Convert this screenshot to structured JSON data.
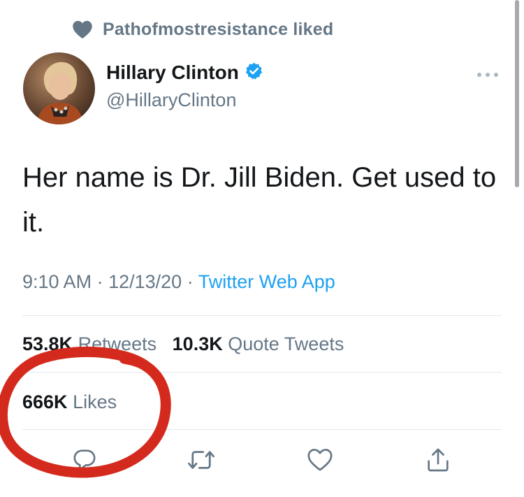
{
  "social_context": {
    "text": "Pathofmostresistance liked",
    "icon": "heart-icon"
  },
  "author": {
    "display_name": "Hillary Clinton",
    "handle": "@HillaryClinton",
    "verified": true,
    "verified_icon": "verified-badge-icon"
  },
  "tweet": {
    "text": "Her name is Dr. Jill Biden. Get used to it."
  },
  "meta": {
    "time": "9:10 AM",
    "date": "12/13/20",
    "separator": "·",
    "source": "Twitter Web App"
  },
  "stats": {
    "retweets_count": "53.8K",
    "retweets_label": "Retweets",
    "quote_count": "10.3K",
    "quote_label": "Quote Tweets",
    "likes_count": "666K",
    "likes_label": "Likes"
  },
  "actions": [
    {
      "name": "reply",
      "icon": "reply-icon"
    },
    {
      "name": "retweet",
      "icon": "retweet-icon"
    },
    {
      "name": "like",
      "icon": "heart-outline-icon"
    },
    {
      "name": "share",
      "icon": "share-icon"
    }
  ],
  "colors": {
    "text_primary": "#14171a",
    "text_secondary": "#657786",
    "link": "#1da1f2",
    "verified": "#1da1f2",
    "divider": "#e1e8ed",
    "annotation_circle": "#d42a1e"
  },
  "annotation": {
    "type": "hand-drawn-circle",
    "target": "likes-count"
  }
}
